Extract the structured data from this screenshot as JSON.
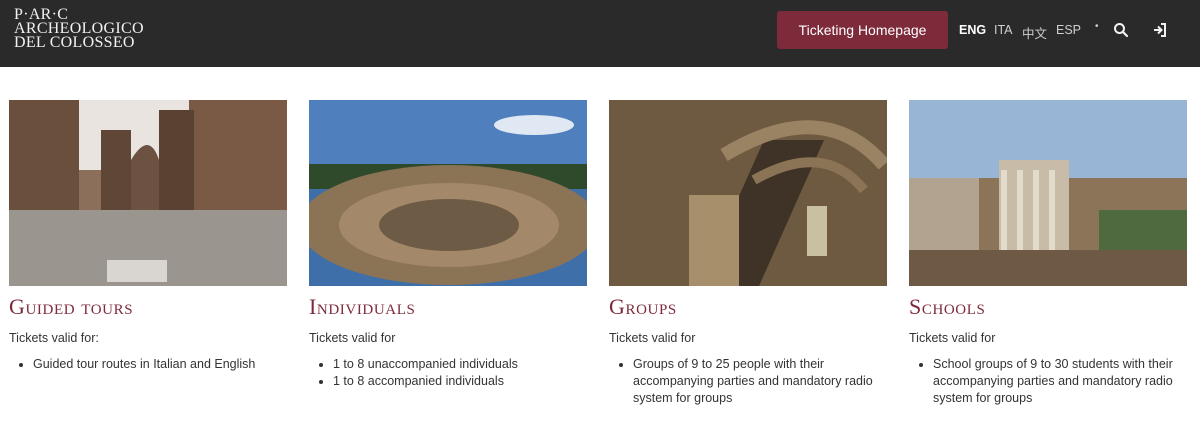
{
  "header": {
    "logo_lines": [
      "P·AR·C",
      "ARCHEOLOGICO",
      "DEL COLOSSEO"
    ],
    "ticketing_button": "Ticketing Homepage",
    "languages": [
      "ENG",
      "ITA",
      "中文",
      "ESP"
    ],
    "active_language": "ENG",
    "icons": [
      "search-icon",
      "login-icon"
    ]
  },
  "cards": [
    {
      "title": "Guided tours",
      "valid_label": "Tickets valid for:",
      "items": [
        "Guided tour routes in Italian and English"
      ]
    },
    {
      "title": "Individuals",
      "valid_label": "Tickets valid for",
      "items": [
        "1 to 8 unaccompanied individuals",
        "1 to 8 accompanied individuals"
      ]
    },
    {
      "title": "Groups",
      "valid_label": "Tickets valid for",
      "items": [
        "Groups of 9 to 25 people with their accompanying parties and mandatory radio system for groups"
      ]
    },
    {
      "title": "Schools",
      "valid_label": "Tickets valid for",
      "items": [
        "School groups of 9 to 30 students with their accompanying parties and mandatory radio system for groups"
      ]
    }
  ],
  "colors": {
    "topbar": "#2b2a2a",
    "accent": "#7d2a3a"
  }
}
